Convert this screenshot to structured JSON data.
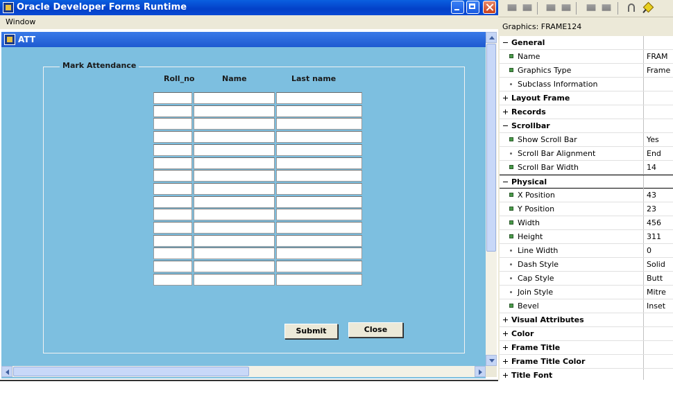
{
  "runtime": {
    "title": "Oracle Developer Forms Runtime",
    "menu_window": "Window",
    "att_window_title": "ATT",
    "frame_title": "Mark Attendance",
    "columns": {
      "roll": "Roll_no",
      "name": "Name",
      "last": "Last name"
    },
    "row_count": 15,
    "submit_label": "Submit",
    "close_label": "Close"
  },
  "palette": {
    "heading": "Graphics: FRAME124",
    "rows": [
      {
        "kind": "section",
        "expanded": true,
        "label": "General",
        "value": ""
      },
      {
        "kind": "item",
        "set": true,
        "label": "Name",
        "value": "FRAM"
      },
      {
        "kind": "item",
        "set": true,
        "label": "Graphics Type",
        "value": "Frame"
      },
      {
        "kind": "item",
        "set": false,
        "label": "Subclass Information",
        "value": ""
      },
      {
        "kind": "section",
        "expanded": false,
        "label": "Layout Frame",
        "value": ""
      },
      {
        "kind": "section",
        "expanded": false,
        "label": "Records",
        "value": ""
      },
      {
        "kind": "section",
        "expanded": true,
        "label": "Scrollbar",
        "value": ""
      },
      {
        "kind": "item",
        "set": true,
        "label": "Show Scroll Bar",
        "value": "Yes"
      },
      {
        "kind": "item",
        "set": false,
        "label": "Scroll Bar Alignment",
        "value": "End"
      },
      {
        "kind": "item",
        "set": true,
        "label": "Scroll Bar Width",
        "value": "14"
      },
      {
        "kind": "section",
        "expanded": true,
        "label": "Physical",
        "value": "",
        "selected": true
      },
      {
        "kind": "item",
        "set": true,
        "label": "X Position",
        "value": "43"
      },
      {
        "kind": "item",
        "set": true,
        "label": "Y Position",
        "value": "23"
      },
      {
        "kind": "item",
        "set": true,
        "label": "Width",
        "value": "456"
      },
      {
        "kind": "item",
        "set": true,
        "label": "Height",
        "value": "311"
      },
      {
        "kind": "item",
        "set": false,
        "label": "Line Width",
        "value": "0"
      },
      {
        "kind": "item",
        "set": false,
        "label": "Dash Style",
        "value": "Solid"
      },
      {
        "kind": "item",
        "set": false,
        "label": "Cap Style",
        "value": "Butt"
      },
      {
        "kind": "item",
        "set": false,
        "label": "Join Style",
        "value": "Mitre"
      },
      {
        "kind": "item",
        "set": true,
        "label": "Bevel",
        "value": "Inset"
      },
      {
        "kind": "section",
        "expanded": false,
        "label": "Visual Attributes",
        "value": ""
      },
      {
        "kind": "section",
        "expanded": false,
        "label": "Color",
        "value": ""
      },
      {
        "kind": "section",
        "expanded": false,
        "label": "Frame Title",
        "value": ""
      },
      {
        "kind": "section",
        "expanded": false,
        "label": "Frame Title Color",
        "value": ""
      },
      {
        "kind": "section",
        "expanded": false,
        "label": "Title Font",
        "value": ""
      }
    ]
  }
}
